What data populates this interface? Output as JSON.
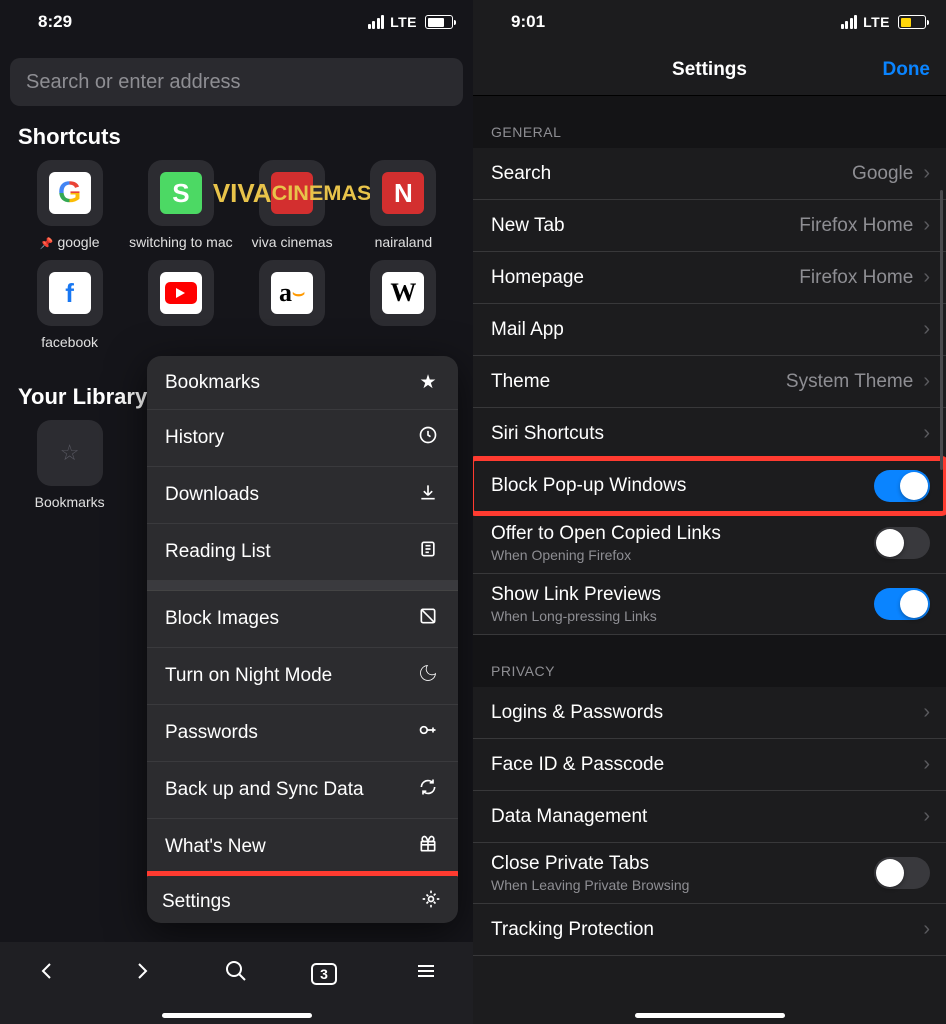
{
  "left": {
    "time": "8:29",
    "carrier": "LTE",
    "search_placeholder": "Search or enter address",
    "shortcuts_title": "Shortcuts",
    "tiles": {
      "google": "google",
      "switching": "switching to mac",
      "viva": "viva cinemas",
      "nairaland": "nairaland",
      "facebook": "facebook"
    },
    "library_title": "Your Library",
    "library_bookmarks": "Bookmarks",
    "menu": {
      "bookmarks": "Bookmarks",
      "history": "History",
      "downloads": "Downloads",
      "reading_list": "Reading List",
      "block_images": "Block Images",
      "night_mode": "Turn on Night Mode",
      "passwords": "Passwords",
      "backup_sync": "Back up and Sync Data",
      "whats_new": "What's New",
      "settings": "Settings"
    },
    "tab_count": "3"
  },
  "right": {
    "time": "9:01",
    "carrier": "LTE",
    "title": "Settings",
    "done": "Done",
    "sections": {
      "general": "GENERAL",
      "privacy": "PRIVACY"
    },
    "rows": {
      "search": {
        "label": "Search",
        "value": "Google"
      },
      "new_tab": {
        "label": "New Tab",
        "value": "Firefox Home"
      },
      "homepage": {
        "label": "Homepage",
        "value": "Firefox Home"
      },
      "mail": {
        "label": "Mail App"
      },
      "theme": {
        "label": "Theme",
        "value": "System Theme"
      },
      "siri": {
        "label": "Siri Shortcuts"
      },
      "popup": {
        "label": "Block Pop-up Windows"
      },
      "copied": {
        "label": "Offer to Open Copied Links",
        "sub": "When Opening Firefox"
      },
      "link_prev": {
        "label": "Show Link Previews",
        "sub": "When Long-pressing Links"
      },
      "logins": {
        "label": "Logins & Passwords"
      },
      "faceid": {
        "label": "Face ID & Passcode"
      },
      "dataman": {
        "label": "Data Management"
      },
      "close_priv": {
        "label": "Close Private Tabs",
        "sub": "When Leaving Private Browsing"
      },
      "tracking": {
        "label": "Tracking Protection"
      }
    }
  }
}
